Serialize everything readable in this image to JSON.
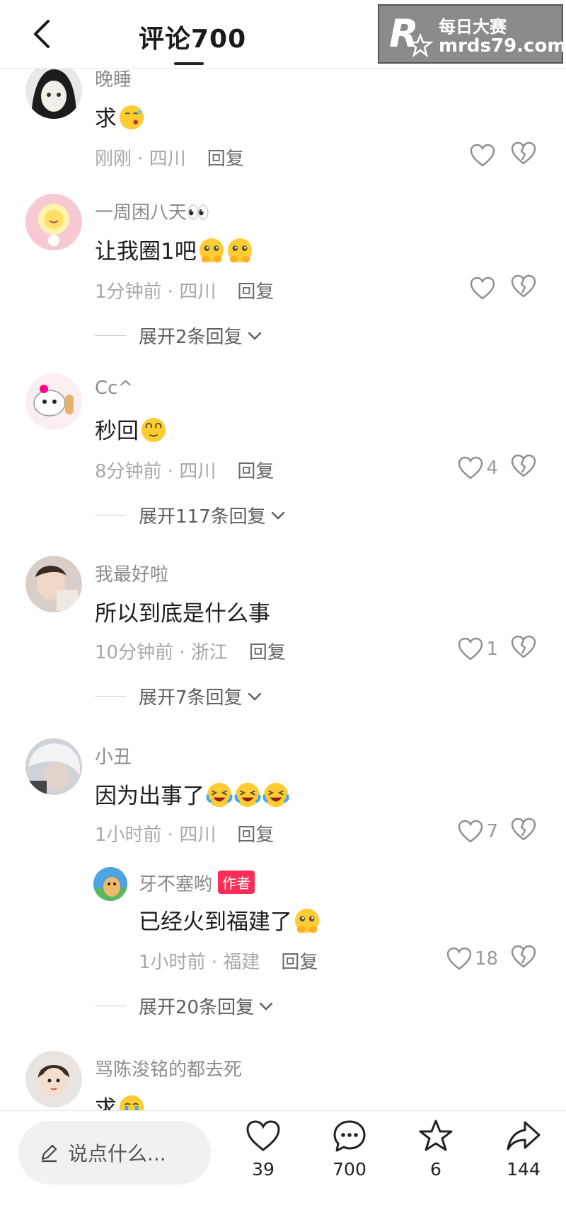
{
  "header": {
    "title": "评论700"
  },
  "watermark": {
    "logo_text": "R",
    "line1": "每日大赛",
    "line2": "mrds79.com"
  },
  "comments": [
    {
      "username": "晚睡",
      "text": "求",
      "emojis": [
        "kiss-emoji"
      ],
      "time_location": "刚刚 · 四川",
      "reply_label": "回复",
      "likes": ""
    },
    {
      "username": "一周困八天👀",
      "text": "让我圈1吧",
      "emojis": [
        "pleading-emoji",
        "pleading-emoji"
      ],
      "time_location": "1分钟前 · 四川",
      "reply_label": "回复",
      "likes": "",
      "expand_label": "展开2条回复"
    },
    {
      "username": "Cc^",
      "text": "秒回",
      "emojis": [
        "dizzy-face-emoji"
      ],
      "time_location": "8分钟前 · 四川",
      "reply_label": "回复",
      "likes": "4",
      "expand_label": "展开117条回复"
    },
    {
      "username": "我最好啦",
      "text": "所以到底是什么事",
      "emojis": [],
      "time_location": "10分钟前 · 浙江",
      "reply_label": "回复",
      "likes": "1",
      "expand_label": "展开7条回复"
    },
    {
      "username": "小丑",
      "text": "因为出事了",
      "emojis": [
        "crying-laughing-emoji",
        "crying-laughing-emoji",
        "crying-laughing-emoji"
      ],
      "time_location": "1小时前 · 四川",
      "reply_label": "回复",
      "likes": "7"
    },
    {
      "username": "牙不塞哟",
      "badge": "作者",
      "text": "已经火到福建了",
      "emojis": [
        "pleading-emoji"
      ],
      "time_location": "1小时前 · 福建",
      "reply_label": "回复",
      "likes": "18",
      "expand_label": "展开20条回复"
    },
    {
      "username": "骂陈浚铭的都去死",
      "text": "求",
      "emojis": [
        "crying-emoji"
      ]
    }
  ],
  "bottom_bar": {
    "input_placeholder": "说点什么...",
    "likes": "39",
    "comments": "700",
    "favorites": "6",
    "shares": "144"
  },
  "colors": {
    "author_badge": "#ff2c55",
    "secondary_text": "#a8a8a8"
  }
}
